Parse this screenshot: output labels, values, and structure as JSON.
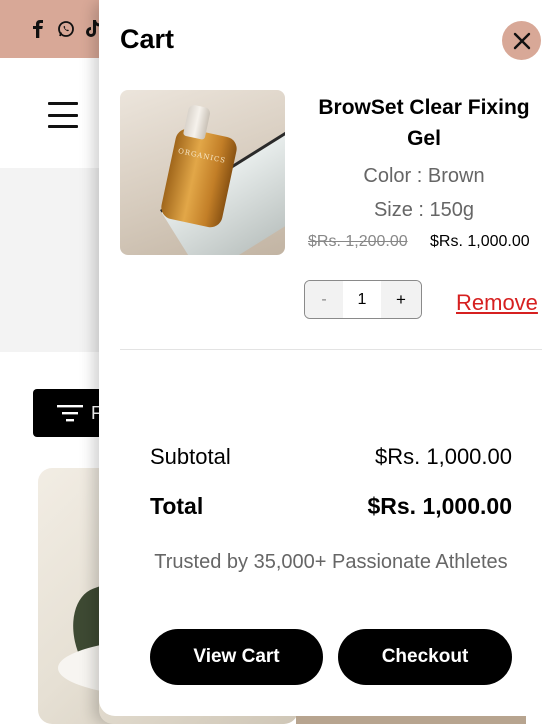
{
  "cart": {
    "title": "Cart",
    "item": {
      "name": "BrowSet Clear Fixing Gel",
      "color": "Color : Brown",
      "size": "Size : 150g",
      "price_old": "$Rs. 1,200.00",
      "price_new": "$Rs. 1,000.00",
      "quantity": "1",
      "qty_minus": "-",
      "qty_plus": "+",
      "remove_label": "Remove",
      "image_label": "ORGANICS"
    },
    "subtotal_label": "Subtotal",
    "subtotal_value": "$Rs. 1,000.00",
    "total_label": "Total",
    "total_value": "$Rs. 1,000.00",
    "trust_text": "Trusted by 35,000+ Passionate Athletes",
    "view_cart_label": "View Cart",
    "checkout_label": "Checkout"
  },
  "page": {
    "filter_label": "F"
  },
  "icons": [
    "facebook-icon",
    "whatsapp-icon",
    "tiktok-icon",
    "menu-icon",
    "close-icon",
    "filter-icon"
  ],
  "colors": {
    "topbar": "#d8a897",
    "close_button": "#d8a897",
    "remove_link": "#d62020",
    "button_bg": "#000000"
  }
}
